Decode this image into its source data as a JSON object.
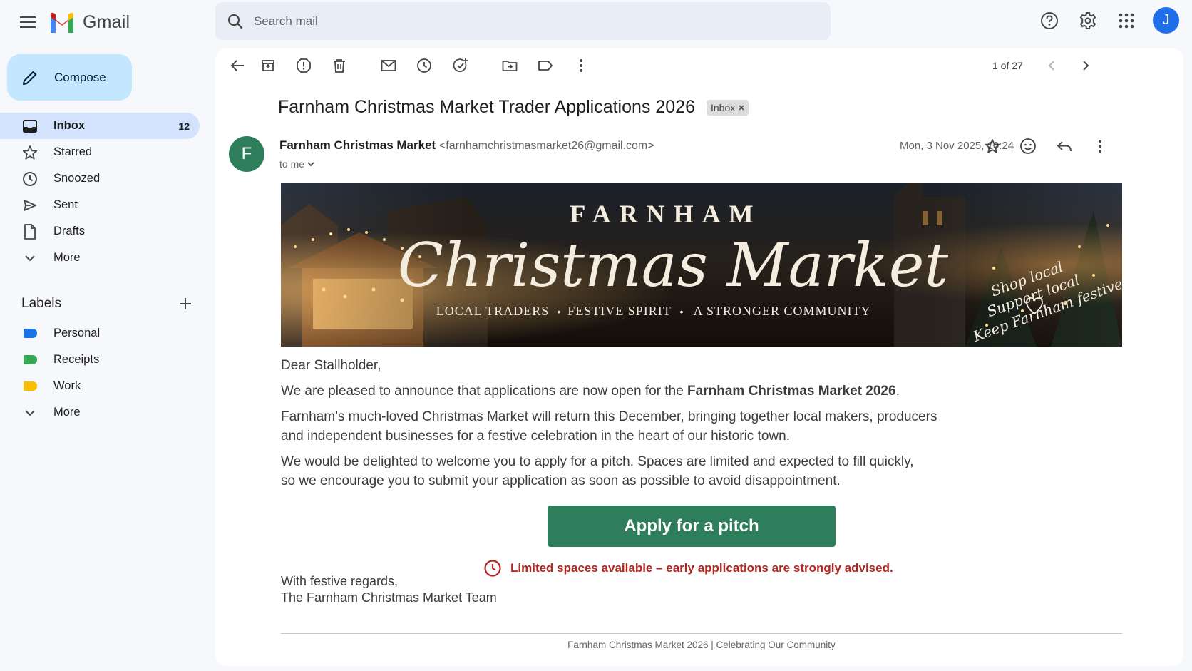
{
  "app": {
    "name": "Gmail"
  },
  "search": {
    "placeholder": "Search mail"
  },
  "user": {
    "initial": "J"
  },
  "sidebar": {
    "compose_label": "Compose",
    "items": [
      {
        "label": "Inbox",
        "count": "12",
        "icon": "inbox-icon"
      },
      {
        "label": "Starred",
        "icon": "star-icon"
      },
      {
        "label": "Snoozed",
        "icon": "clock-icon"
      },
      {
        "label": "Sent",
        "icon": "send-icon"
      },
      {
        "label": "Drafts",
        "icon": "draft-icon"
      },
      {
        "label": "More",
        "icon": "chevron-down-icon"
      }
    ],
    "labels_title": "Labels",
    "labels": [
      {
        "label": "Personal",
        "color": "#1a73e8"
      },
      {
        "label": "Receipts",
        "color": "#34a853"
      },
      {
        "label": "Work",
        "color": "#fbbc04"
      },
      {
        "label": "More"
      }
    ]
  },
  "toolbar": {
    "pager": "1 of 27"
  },
  "email": {
    "subject": "Farnham Christmas Market Trader Applications 2026",
    "chip": "Inbox",
    "sender_initial": "F",
    "sender_name": "Farnham Christmas Market",
    "sender_email": "<farnhamchristmasmarket26@gmail.com>",
    "to": "to me",
    "date": "Mon, 3 Nov 2025, 10:24",
    "banner": {
      "title_top": "FARNHAM",
      "title_script": "Christmas Market",
      "tagline_1": "LOCAL TRADERS",
      "tagline_2": "FESTIVE SPIRIT",
      "tagline_3": "A STRONGER COMMUNITY",
      "side_1": "Shop local",
      "side_2": "Support local",
      "side_3": "Keep Farnham festive"
    },
    "greeting": "Dear Stallholder,",
    "p1_before": "We are pleased to announce that applications are now open for the ",
    "p1_bold": "Farnham Christmas Market 2026",
    "p1_after": ".",
    "p2_line1": "Farnham’s much-loved Christmas Market will return this December, bringing together local makers, producers",
    "p2_line2": "and independent businesses for a festive celebration in the heart of our historic town.",
    "p3_line1": "We would be delighted to welcome you to apply for a pitch. Spaces are limited and expected to fill quickly,",
    "p3_line2": "so we encourage you to submit your application as soon as possible to avoid disappointment.",
    "cta": "Apply for a pitch",
    "notice": "Limited spaces available – early applications are strongly advised.",
    "signoff_1": "With festive regards,",
    "signoff_2": "The Farnham Christmas Market Team",
    "footer": "Farnham Christmas Market 2026 | Celebrating Our Community"
  },
  "colors": {
    "accent_green": "#2e7d5b",
    "notice_red": "#b3261e",
    "compose_bg": "#c2e7ff",
    "active_nav": "#d3e3fd"
  }
}
